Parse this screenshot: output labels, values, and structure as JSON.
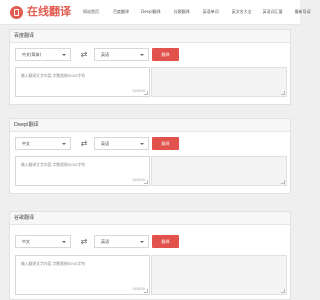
{
  "header": {
    "logo_text": "在线翻译",
    "nav": [
      "网站首页",
      "百度翻译",
      "Deepl翻译",
      "谷歌翻译",
      "英语单词",
      "英文名大全",
      "英语词汇量",
      "最新导读"
    ]
  },
  "colors": {
    "brand": "#e15b4f",
    "button": "#e0524b",
    "page_bg": "#efefef"
  },
  "panels": [
    {
      "title": "百度翻译",
      "source_lang": "中文(简体)",
      "target_lang": "英语",
      "swap_icon": "⇄",
      "button_label": "翻译",
      "placeholder": "输入翻译文字内容,字数限制5000字符",
      "counter": "0/5000"
    },
    {
      "title": "Deepl翻译",
      "source_lang": "中文",
      "target_lang": "英语",
      "swap_icon": "⇄",
      "button_label": "翻译",
      "placeholder": "输入翻译文字内容,字数限制5000字符",
      "counter": "0/5000"
    },
    {
      "title": "谷歌翻译",
      "source_lang": "中文",
      "target_lang": "英语",
      "swap_icon": "⇄",
      "button_label": "翻译",
      "placeholder": "输入翻译文字内容,字数限制5000字符",
      "counter": "0/5000"
    }
  ]
}
